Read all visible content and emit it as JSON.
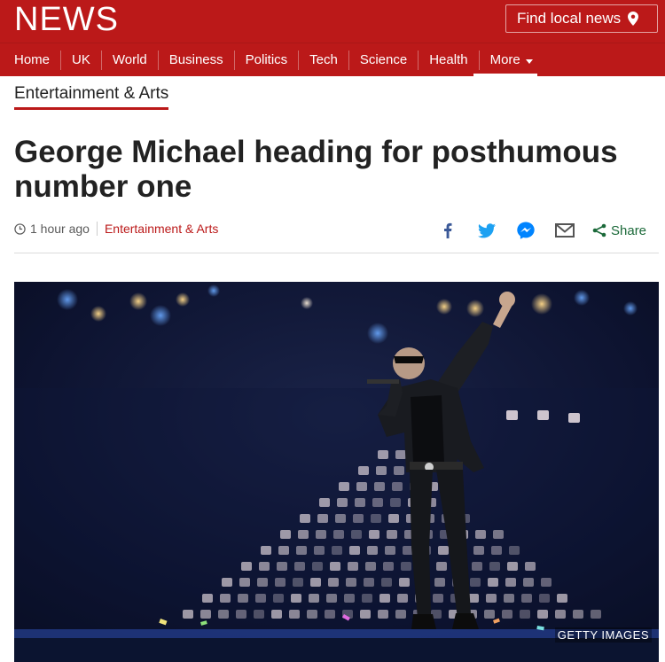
{
  "masthead": {
    "logo_text": "NEWS",
    "find_local": "Find local news",
    "brand_color": "#bb1919"
  },
  "nav": {
    "items": [
      {
        "label": "Home"
      },
      {
        "label": "UK"
      },
      {
        "label": "World"
      },
      {
        "label": "Business"
      },
      {
        "label": "Politics"
      },
      {
        "label": "Tech"
      },
      {
        "label": "Science"
      },
      {
        "label": "Health"
      }
    ],
    "more_label": "More"
  },
  "article": {
    "section": "Entertainment & Arts",
    "headline": "George Michael heading for posthumous number one",
    "timestamp": "1 hour ago",
    "meta_section": "Entertainment & Arts",
    "share_label": "Share",
    "image_credit": "GETTY IMAGES"
  },
  "icons": {
    "location": "location-pin-icon",
    "clock": "clock-icon",
    "facebook": "facebook-icon",
    "twitter": "twitter-icon",
    "messenger": "messenger-icon",
    "email": "email-icon",
    "share": "share-icon"
  }
}
